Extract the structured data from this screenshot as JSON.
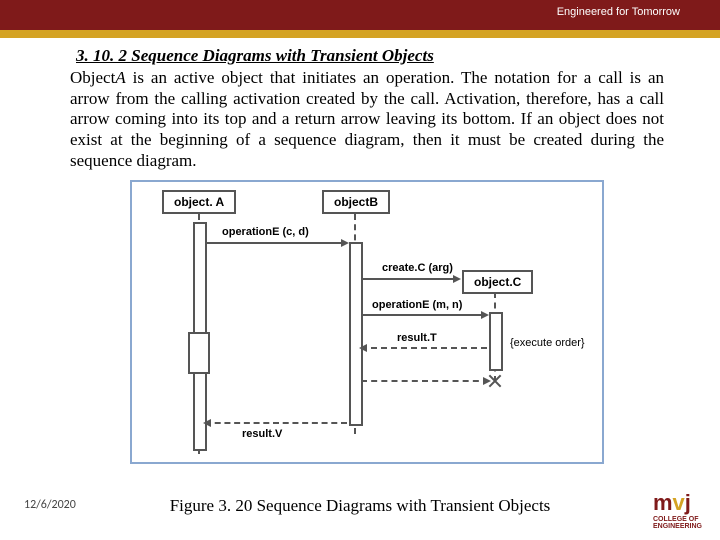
{
  "header": {
    "tagline": "Engineered for Tomorrow"
  },
  "section": {
    "number_title": "3. 10. 2 Sequence Diagrams with Transient Objects",
    "body_prefix": "Object",
    "body_em": "A",
    "body_rest": " is an active object that initiates an operation. The notation for a call is an arrow from the calling activation created by the call. Activation, therefore, has a call arrow coming into its top and a return arrow leaving its bottom. If an object does not exist at the beginning of a sequence diagram, then it must be created during the sequence diagram."
  },
  "diagram": {
    "objA": "object. A",
    "objB": "objectB",
    "objC": "object.C",
    "msg_opE_cd": "operationE (c, d)",
    "msg_createC": "create.C (arg)",
    "msg_opE_mn": "operationE (m, n)",
    "msg_resultT": "result.T",
    "msg_resultV": "result.V",
    "note_exec": "{execute order}"
  },
  "caption": "Figure 3. 20   Sequence Diagrams with Transient Objects",
  "footer_date": "12/6/2020",
  "logo": {
    "m": "m",
    "v": "v",
    "j": "j",
    "line1": "COLLEGE OF",
    "line2": "ENGINEERING"
  }
}
